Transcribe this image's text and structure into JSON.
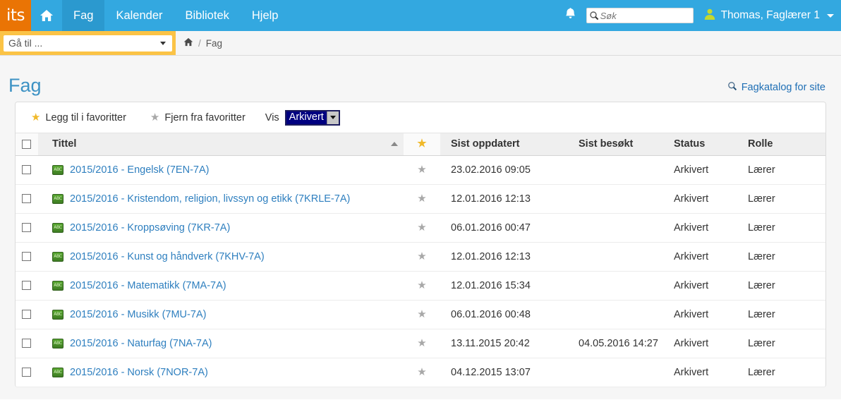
{
  "topnav": {
    "logo": "its",
    "home_icon": "home-icon",
    "tabs": [
      {
        "label": "Fag",
        "active": true
      },
      {
        "label": "Kalender",
        "active": false
      },
      {
        "label": "Bibliotek",
        "active": false
      },
      {
        "label": "Hjelp",
        "active": false
      }
    ],
    "bell_icon": "bell-icon",
    "search": {
      "placeholder": "Søk",
      "value": "",
      "icon": "search-icon"
    },
    "user": {
      "name": "Thomas, Faglærer 1",
      "avatar_icon": "user-avatar-icon"
    },
    "colors": {
      "bar": "#33a8e0",
      "active_tab": "#2b99cf",
      "logo_bg": "#ea7404"
    }
  },
  "secondbar": {
    "goto": {
      "label": "Gå til ...",
      "icon": "chevron-down-icon"
    },
    "breadcrumb": {
      "home_icon": "home-icon",
      "separator": "/",
      "current": "Fag"
    },
    "goto_bar_color": "#fbc346"
  },
  "page": {
    "title": "Fag",
    "catalog_link": {
      "label": "Fagkatalog for site",
      "icon": "search-icon"
    }
  },
  "toolbar": {
    "add_favorite": {
      "label": "Legg til i favoritter",
      "icon": "star-icon-gold"
    },
    "remove_favorite": {
      "label": "Fjern fra favoritter",
      "icon": "star-icon-grey"
    },
    "vis_label": "Vis",
    "filter_select": {
      "value": "Arkivert",
      "focused": true,
      "options": [
        "Arkivert"
      ]
    }
  },
  "table": {
    "headers": {
      "checkbox": "",
      "title": "Tittel",
      "favorite": "star-icon-gold",
      "updated": "Sist oppdatert",
      "visited": "Sist besøkt",
      "status": "Status",
      "role": "Rolle"
    },
    "sort": {
      "column": "Tittel",
      "direction": "asc"
    },
    "rows": [
      {
        "title": "2015/2016 - Engelsk (7EN-7A)",
        "icon": "subject-icon",
        "favorite": false,
        "updated": "23.02.2016 09:05",
        "visited": "",
        "status": "Arkivert",
        "role": "Lærer"
      },
      {
        "title": "2015/2016 - Kristendom, religion, livssyn og etikk (7KRLE-7A)",
        "icon": "subject-icon",
        "favorite": false,
        "updated": "12.01.2016 12:13",
        "visited": "",
        "status": "Arkivert",
        "role": "Lærer"
      },
      {
        "title": "2015/2016 - Kroppsøving (7KR-7A)",
        "icon": "subject-icon",
        "favorite": false,
        "updated": "06.01.2016 00:47",
        "visited": "",
        "status": "Arkivert",
        "role": "Lærer"
      },
      {
        "title": "2015/2016 - Kunst og håndverk (7KHV-7A)",
        "icon": "subject-icon",
        "favorite": false,
        "updated": "12.01.2016 12:13",
        "visited": "",
        "status": "Arkivert",
        "role": "Lærer"
      },
      {
        "title": "2015/2016 - Matematikk (7MA-7A)",
        "icon": "subject-icon",
        "favorite": false,
        "updated": "12.01.2016 15:34",
        "visited": "",
        "status": "Arkivert",
        "role": "Lærer"
      },
      {
        "title": "2015/2016 - Musikk (7MU-7A)",
        "icon": "subject-icon",
        "favorite": false,
        "updated": "06.01.2016 00:48",
        "visited": "",
        "status": "Arkivert",
        "role": "Lærer"
      },
      {
        "title": "2015/2016 - Naturfag (7NA-7A)",
        "icon": "subject-icon",
        "favorite": false,
        "updated": "13.11.2015 20:42",
        "visited": "04.05.2016 14:27",
        "status": "Arkivert",
        "role": "Lærer"
      },
      {
        "title": "2015/2016 - Norsk (7NOR-7A)",
        "icon": "subject-icon",
        "favorite": false,
        "updated": "04.12.2015 13:07",
        "visited": "",
        "status": "Arkivert",
        "role": "Lærer"
      }
    ]
  }
}
